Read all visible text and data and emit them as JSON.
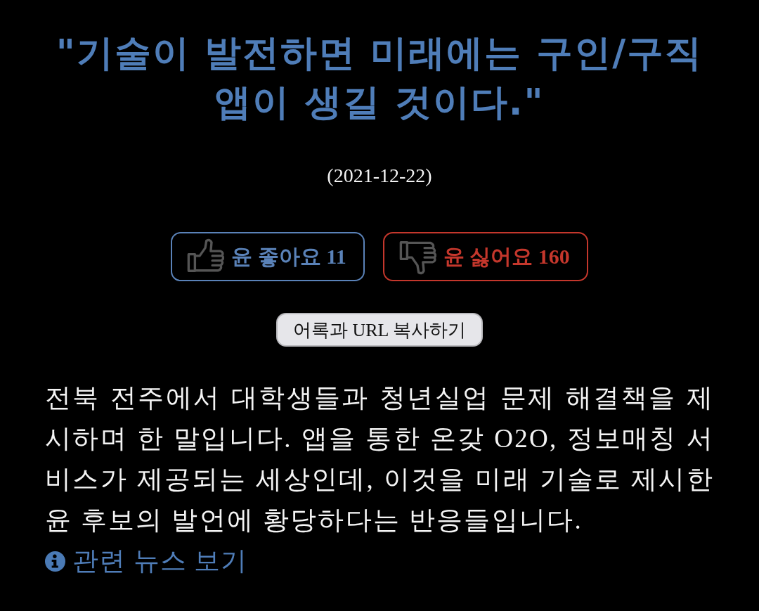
{
  "headline": "\"기술이 발전하면 미래에는 구인/구직 앱이 생길 것이다.\"",
  "date": "(2021-12-22)",
  "reactions": [
    {
      "kind": "like",
      "label": "윤 좋아요 11",
      "color": "#5a82b8"
    },
    {
      "kind": "dislike",
      "label": "윤 싫어요 160",
      "color": "#c4372c"
    }
  ],
  "copy_button": "어록과 URL 복사하기",
  "description": "전북 전주에서 대학생들과 청년실업 문제 해결책을 제시하며 한 말입니다. 앱을 통한 온갖 O2O, 정보매칭 서비스가 제공되는 세상인데, 이것을 미래 기술로 제시한 윤 후보의 발언에 황당하다는 반응들입니다.",
  "related_link": "관련 뉴스 보기"
}
